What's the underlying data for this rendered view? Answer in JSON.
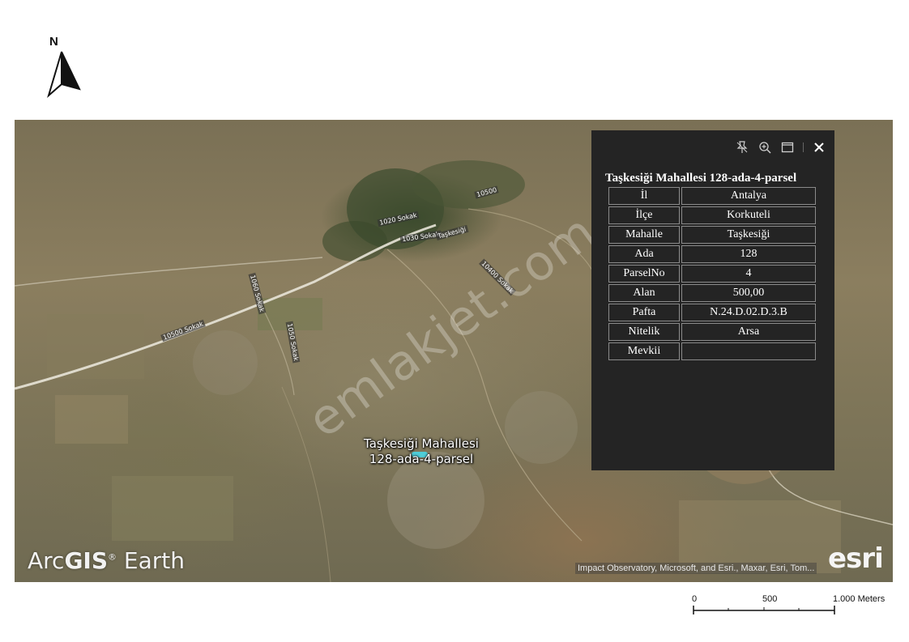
{
  "north_arrow": {
    "letter": "N"
  },
  "map": {
    "watermark": "emlakjet.com",
    "parcel_label": {
      "line1": "Taşkesiği Mahallesi",
      "line2": "128-ada-4-parsel"
    },
    "road_labels": [
      "10500 Sokak",
      "1020 Sokak",
      "1030 Sokak",
      "1060 Sokak",
      "1050 Sokak",
      "10400 Sokak",
      "Taşkesiği",
      "10500"
    ],
    "brand": {
      "arcgis_prefix": "Arc",
      "arcgis_bold": "GIS",
      "registered": "®",
      "arcgis_suffix": " Earth",
      "esri": "esri"
    },
    "attribution": "Impact Observatory, Microsoft, and Esri., Maxar, Esri, Tom..."
  },
  "popup": {
    "toolbar": {
      "pin": "pin-icon",
      "zoom": "zoom-to-icon",
      "dock": "dock-icon",
      "close": "close-icon"
    },
    "title": "Taşkesiği Mahallesi 128-ada-4-parsel",
    "rows": [
      {
        "key": "İl",
        "value": "Antalya"
      },
      {
        "key": "İlçe",
        "value": "Korkuteli"
      },
      {
        "key": "Mahalle",
        "value": "Taşkesiği"
      },
      {
        "key": "Ada",
        "value": "128"
      },
      {
        "key": "ParselNo",
        "value": "4"
      },
      {
        "key": "Alan",
        "value": "500,00"
      },
      {
        "key": "Pafta",
        "value": "N.24.D.02.D.3.B"
      },
      {
        "key": "Nitelik",
        "value": "Arsa"
      },
      {
        "key": "Mevkii",
        "value": ""
      }
    ]
  },
  "scalebar": {
    "label_0": "0",
    "label_mid": "500",
    "label_end": "1.000 Meters"
  }
}
